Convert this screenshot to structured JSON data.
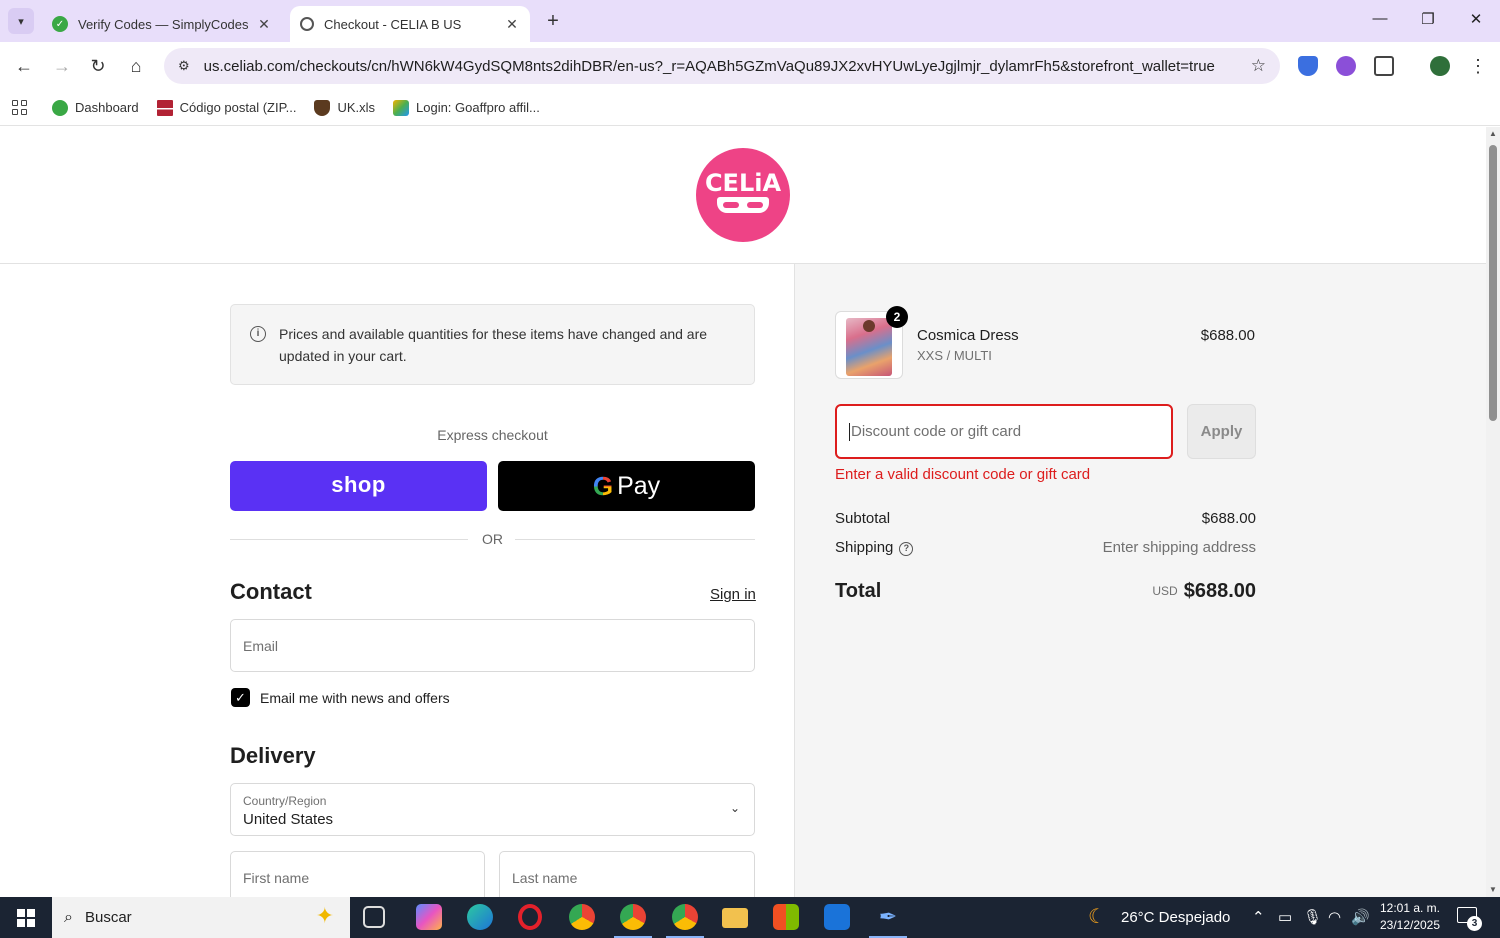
{
  "browser": {
    "tabs": [
      {
        "title": "Verify Codes — SimplyCodes",
        "active": false
      },
      {
        "title": "Checkout - CELIA B US",
        "active": true
      }
    ],
    "url": "us.celiab.com/checkouts/cn/hWN6kW4GydSQM8nts2dihDBR/en-us?_r=AQABh5GZmVaQu89JX2xvHYUwLyeJgjlmjr_dylamrFh5&storefront_wallet=true",
    "bookmarks": [
      "Dashboard",
      "Código postal (ZIP...",
      "UK.xls",
      "Login: Goaffpro affil..."
    ]
  },
  "logo": {
    "text": "CELiA"
  },
  "notice": {
    "text": "Prices and available quantities for these items have changed and are updated in your cart."
  },
  "express": {
    "label": "Express checkout",
    "shop_label": "shop",
    "gpay_g": "G",
    "gpay_label": "Pay",
    "or_label": "OR"
  },
  "contact": {
    "heading": "Contact",
    "signin": "Sign in",
    "email_placeholder": "Email",
    "news_checked": true,
    "news_label": "Email me with news and offers"
  },
  "delivery": {
    "heading": "Delivery",
    "country_label": "Country/Region",
    "country_value": "United States",
    "first_name_placeholder": "First name",
    "last_name_placeholder": "Last name"
  },
  "summary": {
    "item": {
      "name": "Cosmica Dress",
      "variant": "XXS / MULTI",
      "price": "$688.00",
      "quantity": "2"
    },
    "discount_placeholder": "Discount code or gift card",
    "apply_label": "Apply",
    "error": "Enter a valid discount code or gift card",
    "subtotal_label": "Subtotal",
    "subtotal_value": "$688.00",
    "shipping_label": "Shipping",
    "shipping_value": "Enter shipping address",
    "total_label": "Total",
    "total_currency": "USD",
    "total_value": "$688.00"
  },
  "taskbar": {
    "search_placeholder": "Buscar",
    "weather": "26°C  Despejado",
    "time": "12:01 a. m.",
    "date": "23/12/2025",
    "notifications": "3"
  },
  "colors": {
    "brand": "#ee4386",
    "shop": "#5a31f4",
    "error": "#dd1d1d",
    "tabstrip": "#e8defa"
  }
}
